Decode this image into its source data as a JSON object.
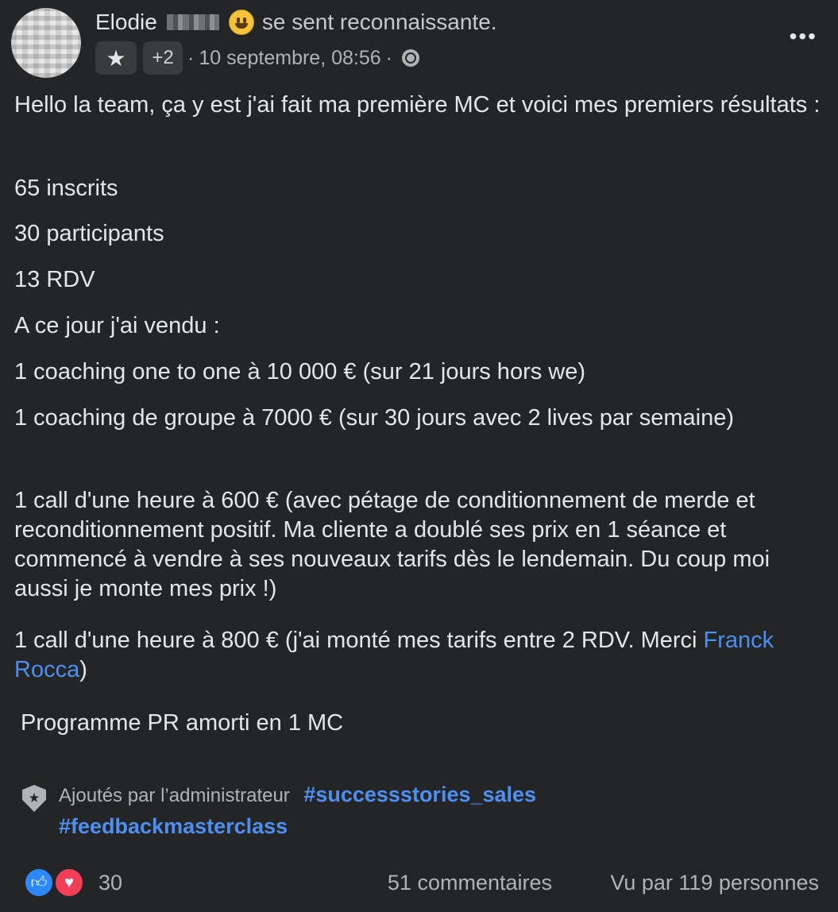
{
  "header": {
    "author_name": "Elodie",
    "feeling_text": "se sent reconnaissante.",
    "badge_more": "+2",
    "date": "10 septembre, 08:56",
    "more_options": "•••"
  },
  "post": {
    "paragraphs": [
      "Hello la team, ça y est j'ai fait ma première MC et voici mes premiers résultats :",
      "65 inscrits",
      "30 participants",
      "13 RDV",
      "A ce jour j'ai vendu :",
      "1 coaching one to one à 10 000 € (sur 21 jours hors we)",
      "1 coaching de groupe à 7000 € (sur 30 jours avec 2 lives par semaine)",
      "1 call d'une heure à 600 € (avec pétage de conditionnement de merde et reconditionnement positif. Ma cliente a doublé ses prix en 1 séance et commencé à vendre à ses nouveaux tarifs dès le lendemain. Du coup moi aussi je monte mes prix !)"
    ],
    "last_call_before": "1 call d'une heure à 800 € (j'ai monté mes tarifs entre 2 RDV. Merci ",
    "mention": "Franck Rocca",
    "last_call_after": ")",
    "closing": "Programme PR amorti en 1 MC"
  },
  "tags": {
    "label": "Ajoutés par l’administrateur",
    "hashtags": [
      "#successstories_sales",
      "#feedbackmasterclass"
    ]
  },
  "footer": {
    "reaction_count": "30",
    "comments": "51 commentaires",
    "views": "Vu par 119 personnes"
  },
  "colors": {
    "background": "#242526",
    "text": "#e4e6eb",
    "secondary_text": "#b0b3b8",
    "link": "#4e8ff2"
  }
}
